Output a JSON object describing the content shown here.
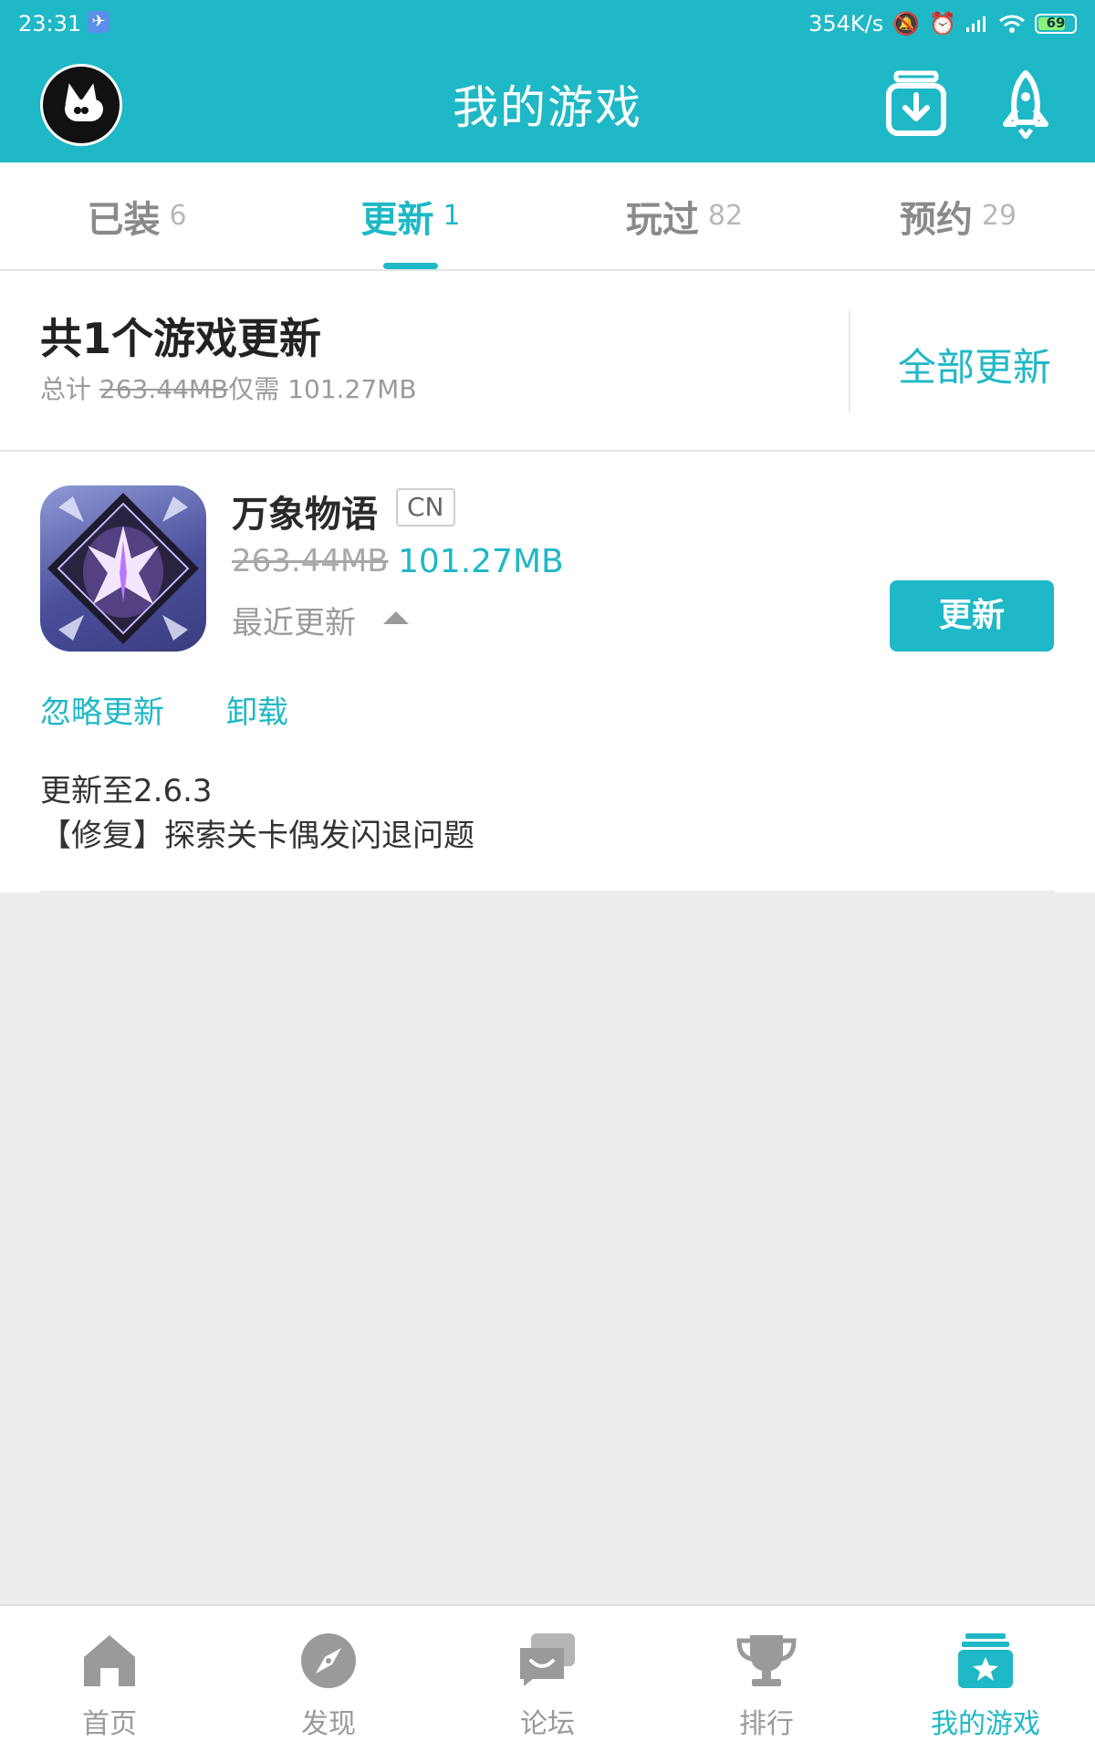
{
  "status_bar": {
    "time": "23:31",
    "net_speed": "354K/s",
    "battery": "69"
  },
  "header": {
    "title": "我的游戏"
  },
  "tabs": [
    {
      "label": "已装",
      "count": "6"
    },
    {
      "label": "更新",
      "count": "1",
      "active": true
    },
    {
      "label": "玩过",
      "count": "82"
    },
    {
      "label": "预约",
      "count": "29"
    }
  ],
  "summary": {
    "heading": "共1个游戏更新",
    "total_label": "总计",
    "total_size": "263.44MB",
    "need_label": "仅需",
    "need_size": "101.27MB",
    "update_all": "全部更新"
  },
  "game": {
    "name": "万象物语",
    "region": "CN",
    "old_size": "263.44MB",
    "new_size": "101.27MB",
    "recent_label": "最近更新",
    "update_button": "更新",
    "ignore_link": "忽略更新",
    "uninstall_link": "卸载",
    "notes_version": "更新至2.6.3",
    "notes_line": "【修复】探索关卡偶发闪退问题"
  },
  "bottom_nav": [
    {
      "label": "首页",
      "icon": "home-icon"
    },
    {
      "label": "发现",
      "icon": "compass-icon"
    },
    {
      "label": "论坛",
      "icon": "chat-icon"
    },
    {
      "label": "排行",
      "icon": "trophy-icon"
    },
    {
      "label": "我的游戏",
      "icon": "my-games-icon",
      "active": true
    }
  ],
  "colors": {
    "accent": "#1fb8c6",
    "inactive": "#9a9a9a",
    "background": "#ededed"
  }
}
